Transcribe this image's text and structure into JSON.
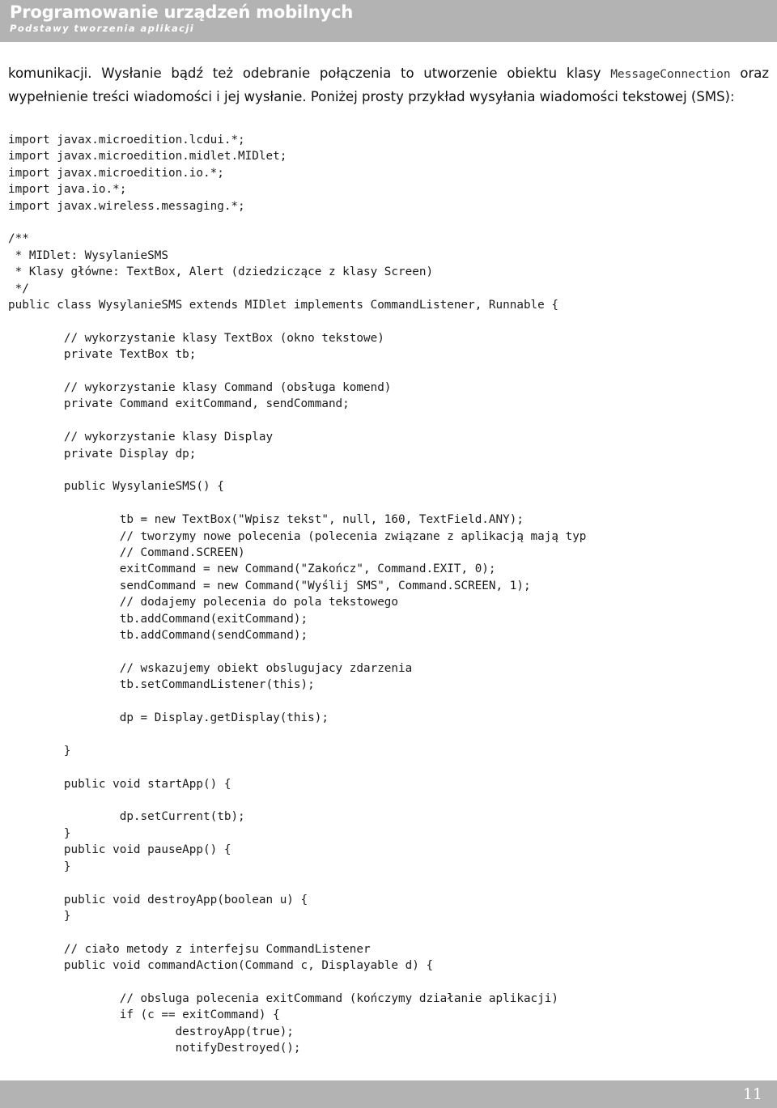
{
  "header": {
    "title": "Programowanie urządzeń mobilnych",
    "subtitle": "Podstawy tworzenia aplikacji",
    "background_color": "#b3b3b3",
    "text_color": "#ffffff"
  },
  "intro": {
    "text_part1": "komunikacji. Wysłanie bądź też odebranie połączenia to utworzenie obiektu klasy ",
    "mono_term": "MessageConnection",
    "text_part2": " oraz wypełnienie treści wiadomości i jej wysłanie. Poniżej prosty przykład wysyłania wiadomości tekstowej (SMS):"
  },
  "code": {
    "language": "java",
    "lines": [
      "import javax.microedition.lcdui.*;",
      "import javax.microedition.midlet.MIDlet;",
      "import javax.microedition.io.*;",
      "import java.io.*;",
      "import javax.wireless.messaging.*;",
      "",
      "/**",
      " * MIDlet: WysylanieSMS",
      " * Klasy główne: TextBox, Alert (dziedziczące z klasy Screen)",
      " */",
      "public class WysylanieSMS extends MIDlet implements CommandListener, Runnable {",
      "",
      "        // wykorzystanie klasy TextBox (okno tekstowe)",
      "        private TextBox tb;",
      "",
      "        // wykorzystanie klasy Command (obsługa komend)",
      "        private Command exitCommand, sendCommand;",
      "",
      "        // wykorzystanie klasy Display",
      "        private Display dp;",
      "",
      "        public WysylanieSMS() {",
      "",
      "                tb = new TextBox(\"Wpisz tekst\", null, 160, TextField.ANY);",
      "                // tworzymy nowe polecenia (polecenia związane z aplikacją mają typ",
      "                // Command.SCREEN)",
      "                exitCommand = new Command(\"Zakończ\", Command.EXIT, 0);",
      "                sendCommand = new Command(\"Wyślij SMS\", Command.SCREEN, 1);",
      "                // dodajemy polecenia do pola tekstowego",
      "                tb.addCommand(exitCommand);",
      "                tb.addCommand(sendCommand);",
      "",
      "                // wskazujemy obiekt obslugujacy zdarzenia",
      "                tb.setCommandListener(this);",
      "",
      "                dp = Display.getDisplay(this);",
      "",
      "        }",
      "",
      "        public void startApp() {",
      "",
      "                dp.setCurrent(tb);",
      "        }",
      "        public void pauseApp() {",
      "        }",
      "",
      "        public void destroyApp(boolean u) {",
      "        }",
      "",
      "        // ciało metody z interfejsu CommandListener",
      "        public void commandAction(Command c, Displayable d) {",
      "",
      "                // obsluga polecenia exitCommand (kończymy działanie aplikacji)",
      "                if (c == exitCommand) {",
      "                        destroyApp(true);",
      "                        notifyDestroyed();"
    ]
  },
  "footer": {
    "page_number": "11",
    "background_color": "#b3b3b3",
    "text_color": "#ffffff"
  }
}
